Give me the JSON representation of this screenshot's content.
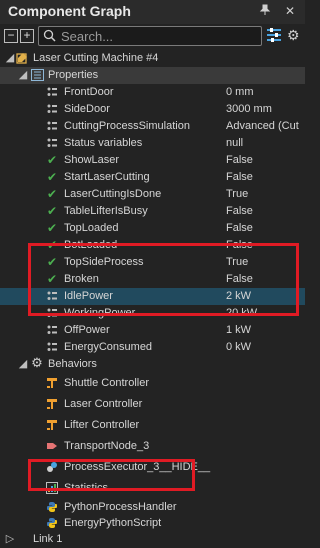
{
  "panel": {
    "title": "Component Graph"
  },
  "toolbar": {
    "collapse_label": "−",
    "expand_label": "+",
    "search_placeholder": "Search..."
  },
  "tree": {
    "root_label": "Laser Cutting Machine #4",
    "properties_label": "Properties",
    "properties": [
      {
        "name": "FrontDoor",
        "value": "0 mm",
        "icon": "property-icon"
      },
      {
        "name": "SideDoor",
        "value": "3000 mm",
        "icon": "property-icon"
      },
      {
        "name": "CuttingProcessSimulation",
        "value": "Advanced (Cut",
        "icon": "property-icon"
      },
      {
        "name": "Status variables",
        "value": "null",
        "icon": "property-icon"
      },
      {
        "name": "ShowLaser",
        "value": "False",
        "icon": "check-icon"
      },
      {
        "name": "StartLaserCutting",
        "value": "False",
        "icon": "check-icon"
      },
      {
        "name": "LaserCuttingIsDone",
        "value": "True",
        "icon": "check-icon"
      },
      {
        "name": "TableLifterIsBusy",
        "value": "False",
        "icon": "check-icon"
      },
      {
        "name": "TopLoaded",
        "value": "False",
        "icon": "check-icon"
      },
      {
        "name": "BotLoaded",
        "value": "False",
        "icon": "check-icon"
      },
      {
        "name": "TopSideProcess",
        "value": "True",
        "icon": "check-icon"
      },
      {
        "name": "Broken",
        "value": "False",
        "icon": "check-icon"
      },
      {
        "name": "IdlePower",
        "value": "2 kW",
        "icon": "property-icon"
      },
      {
        "name": "WorkingPower",
        "value": "20 kW",
        "icon": "property-icon"
      },
      {
        "name": "OffPower",
        "value": "1 kW",
        "icon": "property-icon"
      },
      {
        "name": "EnergyConsumed",
        "value": "0 kW",
        "icon": "property-icon"
      }
    ],
    "behaviors_label": "Behaviors",
    "behaviors": [
      {
        "name": "Shuttle Controller"
      },
      {
        "name": "Laser Controller"
      },
      {
        "name": "Lifter Controller"
      },
      {
        "name": "TransportNode_3"
      },
      {
        "name": "ProcessExecutor_3__HIDE__"
      },
      {
        "name": "Statistics"
      },
      {
        "name": "PythonProcessHandler"
      },
      {
        "name": "EnergyPythonScript"
      }
    ],
    "link_label": "Link 1"
  },
  "colors": {
    "highlight_border": "#e01b24",
    "selected_row": "#214a5e",
    "check": "#4caf50",
    "folder": "#e2b04a"
  }
}
